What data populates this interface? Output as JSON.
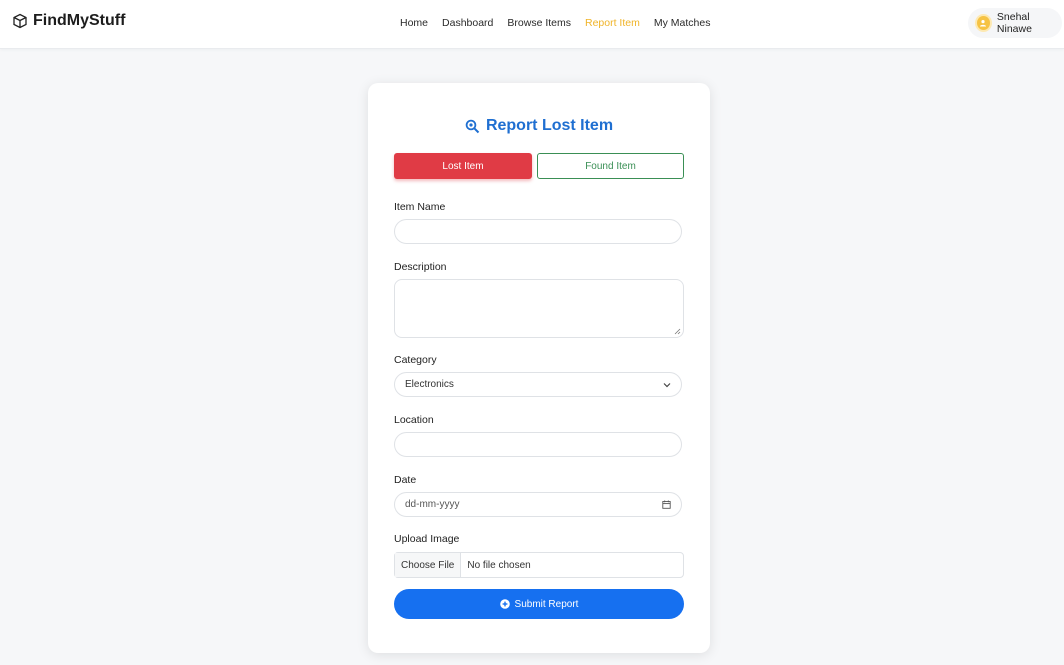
{
  "brand": {
    "name": "FindMyStuff",
    "icon": "box-icon"
  },
  "nav": {
    "links": [
      "Home",
      "Dashboard",
      "Browse Items",
      "Report Item",
      "My Matches"
    ],
    "active": "Report Item",
    "active_color": "#f0b429"
  },
  "user": {
    "name": "Snehal Ninawe",
    "avatar_color": "#f6c344"
  },
  "form": {
    "title": "Report Lost Item",
    "title_icon": "magnifier-icon",
    "title_color": "#1f6fd1",
    "toggle": {
      "lost_label": "Lost Item",
      "found_label": "Found Item",
      "selected": "Lost Item"
    },
    "item_name": {
      "label": "Item Name",
      "value": ""
    },
    "description": {
      "label": "Description",
      "value": ""
    },
    "category": {
      "label": "Category",
      "value": "Electronics"
    },
    "location": {
      "label": "Location",
      "value": ""
    },
    "date": {
      "label": "Date",
      "placeholder": "dd-mm-yyyy"
    },
    "upload": {
      "label": "Upload Image",
      "button": "Choose File",
      "status": "No file chosen"
    },
    "submit_label": "Submit Report"
  },
  "colors": {
    "lost": "#e03b45",
    "found": "#3a8f55",
    "submit": "#1670f0"
  }
}
